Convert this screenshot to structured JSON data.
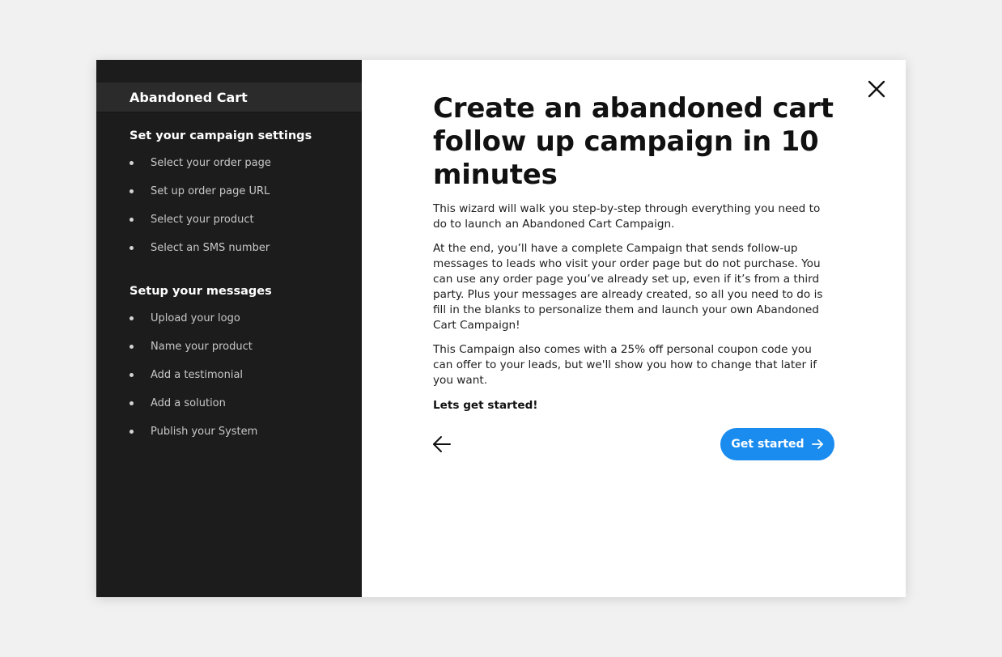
{
  "sidebar": {
    "header": "Abandoned Cart",
    "sections": [
      {
        "title": "Set your campaign settings",
        "steps": [
          "Select your order page",
          "Set up order page URL",
          "Select your product",
          "Select an SMS number"
        ]
      },
      {
        "title": "Setup your messages",
        "steps": [
          "Upload your logo",
          "Name your product",
          "Add a testimonial",
          "Add a solution",
          "Publish your System"
        ]
      }
    ]
  },
  "main": {
    "title": "Create an abandoned cart follow up campaign in 10 minutes",
    "paragraphs": [
      "This wizard will walk you step-by-step through everything you need to do to launch an Abandoned Cart Campaign.",
      "At the end, you’ll have a complete Campaign that sends follow-up messages to leads who visit your order page but do not purchase. You can use any order page you’ve already set up, even if it’s from a third party. Plus your messages are already created, so all you need to do is fill in the blanks to personalize them and launch your own Abandoned Cart Campaign!",
      "This Campaign also comes with a 25% off personal coupon code you can offer to your leads, but we'll show you how to change that later if you want."
    ],
    "emphasis": "Lets get started!",
    "primary_button": "Get started",
    "icons": {
      "close": "close-icon",
      "back": "arrow-left-icon",
      "forward": "arrow-right-icon"
    }
  },
  "colors": {
    "sidebar_bg": "#1c1c1c",
    "sidebar_header_bg": "#2b2b2b",
    "accent": "#1a8cf0",
    "page_bg": "#f1f1f1"
  }
}
